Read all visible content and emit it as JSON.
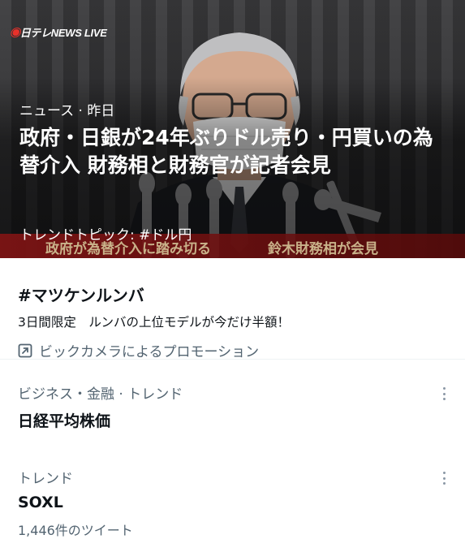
{
  "hero": {
    "logo": "日テレNEWS LIVE",
    "meta": "ニュース · 昨日",
    "headline": "政府・日銀が24年ぶりドル売り・円買いの為替介入 財務相と財務官が記者会見",
    "topic": "トレンドトピック: #ドル円",
    "caption_left": "政府が為替介入に踏み切る",
    "caption_right": "鈴木財務相が会見"
  },
  "promo": {
    "hashtag": "#マツケンルンバ",
    "description": "3日間限定　ルンバの上位モデルが今だけ半額！",
    "promoted_by": "ビックカメラによるプロモーション",
    "promoted_icon": "promoted-arrow-icon"
  },
  "trends": [
    {
      "category": "ビジネス・金融 · トレンド",
      "name": "日経平均株価",
      "count": ""
    },
    {
      "category": "トレンド",
      "name": "SOXL",
      "count": "1,446件のツイート"
    }
  ],
  "colors": {
    "secondary_text": "#536471",
    "primary_text": "#0f1419",
    "divider": "#eff3f4"
  }
}
